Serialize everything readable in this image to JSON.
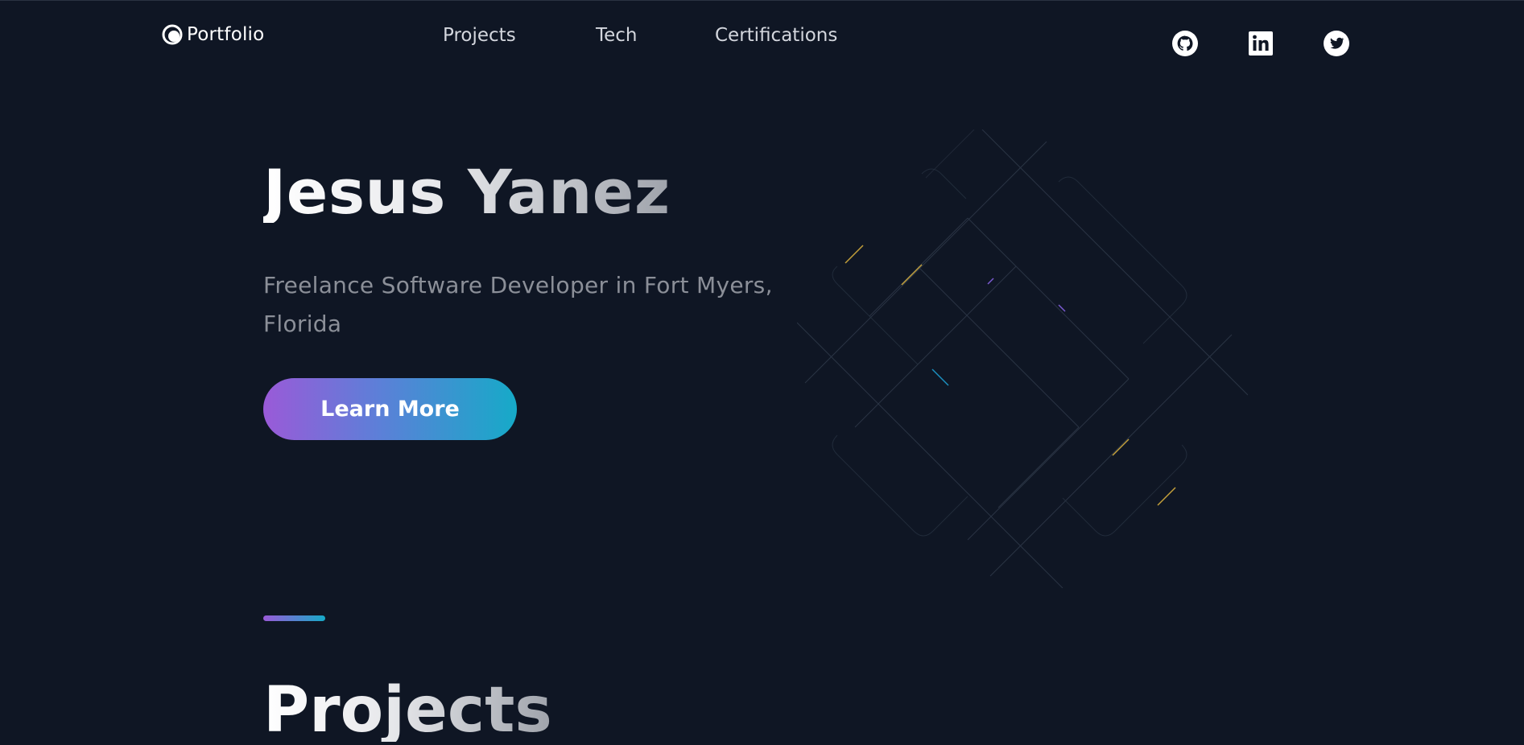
{
  "header": {
    "logo_text": "Portfolio",
    "nav": [
      {
        "label": "Projects"
      },
      {
        "label": "Tech"
      },
      {
        "label": "Certifications"
      }
    ],
    "social_icons": [
      "github-icon",
      "linkedin-icon",
      "twitter-icon"
    ]
  },
  "hero": {
    "name": "Jesus Yanez",
    "subtitle": "Freelance Software Developer in Fort Myers, Florida",
    "cta_label": "Learn More"
  },
  "projects_section": {
    "title": "Projects"
  },
  "colors": {
    "background": "#0f1624",
    "gradient_start": "#9a5ad8",
    "gradient_end": "#16aac8",
    "nav_text": "#d3d6dd",
    "subtitle_text": "#8b8f98"
  }
}
